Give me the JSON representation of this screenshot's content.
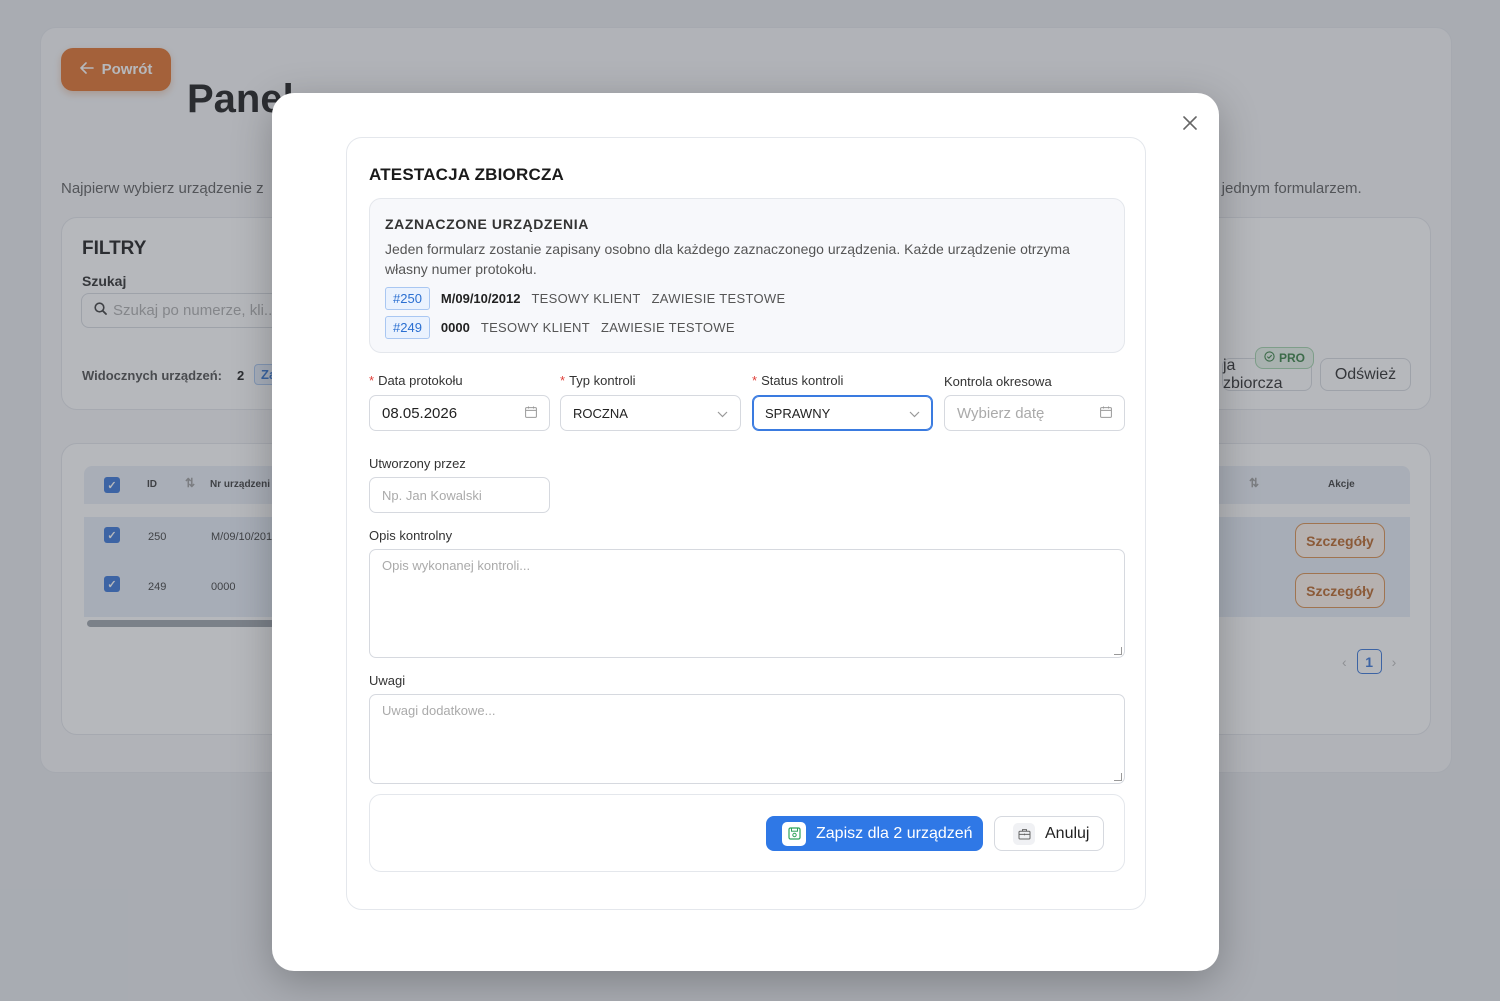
{
  "background": {
    "back_label": "Powrót",
    "page_title": "Panel",
    "subtitle_left": "Najpierw wybierz urządzenie z",
    "subtitle_right": "z jednym formularzem.",
    "filters": {
      "title": "FILTRY",
      "search_label": "Szukaj",
      "search_placeholder": "Szukaj po numerze, kli...",
      "visible_label": "Widocznych urządzeń:",
      "visible_count": "2",
      "visible_tag": "Za",
      "bulk_label": "ja zbiorcza",
      "pro_badge": "PRO",
      "refresh_label": "Odśwież"
    },
    "table": {
      "columns": [
        "ID",
        "Nr urządzeni",
        "Akcje"
      ],
      "rows": [
        {
          "id": "250",
          "nr": "M/09/10/201",
          "action": "Szczegóły"
        },
        {
          "id": "249",
          "nr": "0000",
          "action": "Szczegóły"
        }
      ],
      "page": "1"
    }
  },
  "modal": {
    "title": "ATESTACJA ZBIORCZA",
    "selected": {
      "title": "ZAZNACZONE URZĄDZENIA",
      "description": "Jeden formularz zostanie zapisany osobno dla każdego zaznaczonego urządzenia. Każde urządzenie otrzyma własny numer protokołu.",
      "devices": [
        {
          "id": "#250",
          "number": "M/09/10/2012",
          "client": "TESOWY KLIENT",
          "location": "ZAWIESIE TESTOWE"
        },
        {
          "id": "#249",
          "number": "0000",
          "client": "TESOWY KLIENT",
          "location": "ZAWIESIE TESTOWE"
        }
      ]
    },
    "fields": {
      "date_label": "Data protokołu",
      "date_value": "08.05.2026",
      "type_label": "Typ kontroli",
      "type_value": "ROCZNA",
      "status_label": "Status kontroli",
      "status_value": "SPRAWNY",
      "periodic_label": "Kontrola okresowa",
      "periodic_placeholder": "Wybierz datę",
      "created_label": "Utworzony przez",
      "created_placeholder": "Np. Jan Kowalski",
      "description_label": "Opis kontrolny",
      "description_placeholder": "Opis wykonanej kontroli...",
      "notes_label": "Uwagi",
      "notes_placeholder": "Uwagi dodatkowe..."
    },
    "actions": {
      "save_label": "Zapisz dla 2 urządzeń",
      "cancel_label": "Anuluj"
    }
  },
  "colors": {
    "primary": "#2f78e6",
    "accent_orange": "#e06a1f",
    "required": "#e0403a"
  }
}
